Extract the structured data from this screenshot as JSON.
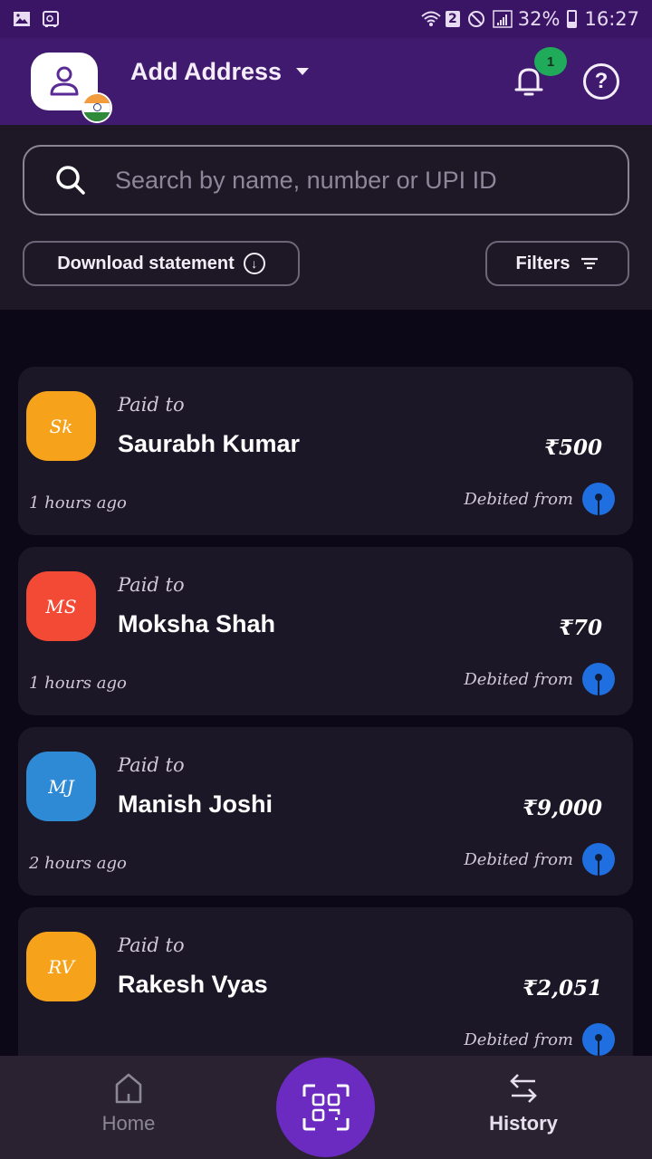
{
  "status_bar": {
    "left_icons": [
      "gallery-icon",
      "safe-icon"
    ],
    "sim_slot": "2",
    "battery_percent": "32%",
    "time": "16:27"
  },
  "header": {
    "title": "Add Address",
    "notification_count": "1",
    "brand_color": "#3f1a6e"
  },
  "search": {
    "placeholder": "Search by name, number or UPI ID",
    "value": ""
  },
  "actions": {
    "download_label": "Download statement",
    "filters_label": "Filters"
  },
  "transactions": [
    {
      "initials": "Sk",
      "avatar_color": "#f7a21b",
      "label": "Paid to",
      "name": "Saurabh Kumar",
      "amount": "₹500",
      "time": "1 hours ago",
      "debit_label": "Debited from"
    },
    {
      "initials": "MS",
      "avatar_color": "#f24a35",
      "label": "Paid to",
      "name": "Moksha Shah",
      "amount": "₹70",
      "time": "1 hours ago",
      "debit_label": "Debited from"
    },
    {
      "initials": "MJ",
      "avatar_color": "#2f8ad6",
      "label": "Paid to",
      "name": "Manish Joshi",
      "amount": "₹9,000",
      "time": "2 hours ago",
      "debit_label": "Debited from"
    },
    {
      "initials": "RV",
      "avatar_color": "#f7a21b",
      "label": "Paid to",
      "name": "Rakesh Vyas",
      "amount": "₹2,051",
      "debit_label": "Debited from"
    }
  ],
  "bottom_nav": {
    "home_label": "Home",
    "history_label": "History",
    "active": "History"
  }
}
